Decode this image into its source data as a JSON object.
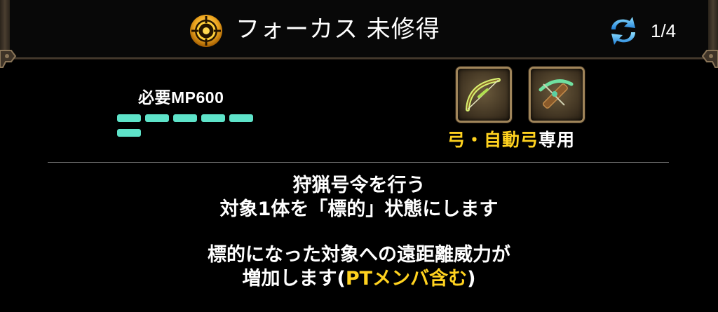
{
  "header": {
    "skill_icon": "focus-crosshair-icon",
    "title": "フォーカス 未修得",
    "cycle_icon": "cycle-arrows-icon",
    "page_indicator": "1/4"
  },
  "mp": {
    "label": "必要MP600",
    "bar_color": "#5ee3c9"
  },
  "weapons": {
    "slots": [
      {
        "icon": "bow-icon"
      },
      {
        "icon": "crossbow-icon"
      }
    ],
    "restriction_highlight": "弓・自動弓",
    "restriction_suffix": "専用"
  },
  "description": {
    "line1": "狩猟号令を行う",
    "line2": "対象1体を「標的」状態にします",
    "line3": "標的になった対象への遠距離威力が",
    "line4_prefix": "増加します",
    "line4_open": "(",
    "line4_highlight": "PTメンバ含む",
    "line4_close": ")"
  },
  "colors": {
    "accent_yellow": "#ffd21f",
    "mp_teal": "#5ee3c9",
    "frame_bronze": "#6a5a45"
  }
}
